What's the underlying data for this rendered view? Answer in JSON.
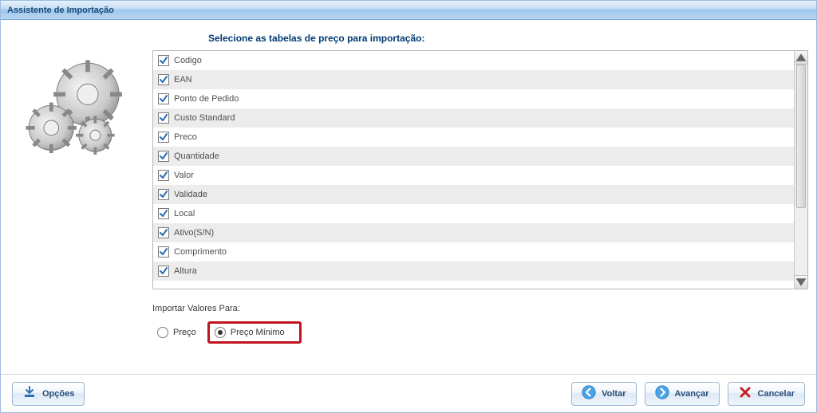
{
  "window": {
    "title": "Assistente de Importação"
  },
  "main": {
    "instruction": "Selecione as tabelas de preço para importação:",
    "items": [
      {
        "label": "Codigo",
        "checked": true
      },
      {
        "label": "EAN",
        "checked": true
      },
      {
        "label": "Ponto de Pedido",
        "checked": true
      },
      {
        "label": "Custo Standard",
        "checked": true
      },
      {
        "label": "Preco",
        "checked": true
      },
      {
        "label": "Quantidade",
        "checked": true
      },
      {
        "label": "Valor",
        "checked": true
      },
      {
        "label": "Validade",
        "checked": true
      },
      {
        "label": "Local",
        "checked": true
      },
      {
        "label": "Ativo(S/N)",
        "checked": true
      },
      {
        "label": "Comprimento",
        "checked": true
      },
      {
        "label": "Altura",
        "checked": true
      }
    ],
    "radio_title": "Importar Valores Para:",
    "radio_options": [
      {
        "label": "Preço",
        "selected": false
      },
      {
        "label": "Preço Mínimo",
        "selected": true,
        "highlighted": true
      }
    ]
  },
  "footer": {
    "options": "Opções",
    "back": "Voltar",
    "next": "Avançar",
    "cancel": "Cancelar"
  }
}
